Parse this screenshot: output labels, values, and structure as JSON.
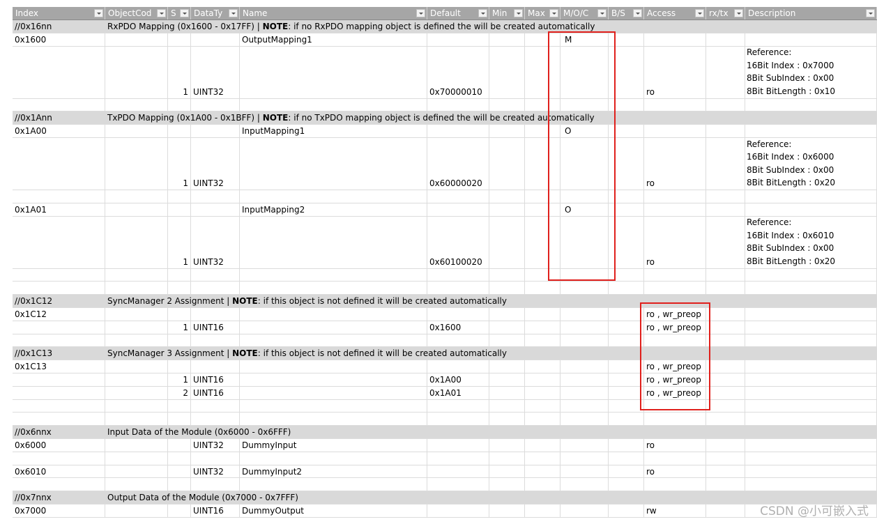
{
  "header": {
    "columns": [
      "Index",
      "ObjectCod",
      "S",
      "DataTy",
      "Name",
      "Default",
      "Min",
      "Max",
      "M/O/C",
      "B/S",
      "Access",
      "rx/tx",
      "Description"
    ]
  },
  "rows": [
    {
      "type": "section",
      "index": "//0x16nn",
      "title_prefix": "RxPDO Mapping (0x1600 - 0x17FF) | ",
      "note": "NOTE",
      "title_suffix": ": if no RxPDO mapping object is defined the will  be created automatically"
    },
    {
      "type": "data",
      "index": "0x1600",
      "name": "OutputMapping1",
      "moc": "M"
    },
    {
      "type": "entry",
      "sub": "1",
      "dtype": "UINT32",
      "default": "0x70000010",
      "access": "ro",
      "desc": "Reference:\n16Bit Index : 0x7000\n8Bit SubIndex : 0x00\n8Bit BitLength : 0x10"
    },
    {
      "type": "blank"
    },
    {
      "type": "section",
      "index": "//0x1Ann",
      "title_prefix": "TxPDO Mapping (0x1A00 - 0x1BFF) | ",
      "note": "NOTE",
      "title_suffix": ": if no TxPDO mapping object is defined the will  be created automatically"
    },
    {
      "type": "data",
      "index": "0x1A00",
      "name": "InputMapping1",
      "moc": "O"
    },
    {
      "type": "entry",
      "sub": "1",
      "dtype": "UINT32",
      "default": "0x60000020",
      "access": "ro",
      "desc": "Reference:\n16Bit Index : 0x6000\n8Bit SubIndex : 0x00\n8Bit BitLength : 0x20"
    },
    {
      "type": "blank"
    },
    {
      "type": "data",
      "index": "0x1A01",
      "name": "InputMapping2",
      "moc": "O"
    },
    {
      "type": "entry",
      "sub": "1",
      "dtype": "UINT32",
      "default": "0x60100020",
      "access": "ro",
      "desc": "Reference:\n16Bit Index : 0x6010\n8Bit SubIndex : 0x00\n8Bit BitLength : 0x20"
    },
    {
      "type": "blank"
    },
    {
      "type": "blank"
    },
    {
      "type": "section",
      "index": "//0x1C12",
      "title_prefix": "SyncManager 2 Assignment | ",
      "note": "NOTE",
      "title_suffix": ": if this object is not defined it will  be created automatically"
    },
    {
      "type": "data",
      "index": "0x1C12",
      "access": "ro , wr_preop"
    },
    {
      "type": "data",
      "sub": "1",
      "dtype": "UINT16",
      "default": "0x1600",
      "access": "ro , wr_preop"
    },
    {
      "type": "blank"
    },
    {
      "type": "section",
      "index": "//0x1C13",
      "title_prefix": "SyncManager 3 Assignment | ",
      "note": "NOTE",
      "title_suffix": ": if this object is not defined it will  be created automatically"
    },
    {
      "type": "data",
      "index": "0x1C13",
      "access": "ro , wr_preop"
    },
    {
      "type": "data",
      "sub": "1",
      "dtype": "UINT16",
      "default": "0x1A00",
      "access": "ro , wr_preop"
    },
    {
      "type": "data",
      "sub": "2",
      "dtype": "UINT16",
      "default": "0x1A01",
      "access": "ro , wr_preop"
    },
    {
      "type": "blank"
    },
    {
      "type": "blank"
    },
    {
      "type": "section",
      "index": "//0x6nnx",
      "title_prefix": "Input Data of the Module (0x6000 - 0x6FFF)",
      "note": "",
      "title_suffix": ""
    },
    {
      "type": "data",
      "index": "0x6000",
      "dtype": "UINT32",
      "name": "DummyInput",
      "access": "ro"
    },
    {
      "type": "blank"
    },
    {
      "type": "data",
      "index": "0x6010",
      "dtype": "UINT32",
      "name": "DummyInput2",
      "access": "ro"
    },
    {
      "type": "blank"
    },
    {
      "type": "section",
      "index": "//0x7nnx",
      "title_prefix": "Output Data of the Module (0x7000 - 0x7FFF)",
      "note": "",
      "title_suffix": ""
    },
    {
      "type": "data",
      "index": "0x7000",
      "dtype": "UINT16",
      "name": "DummyOutput",
      "access": "rw"
    }
  ],
  "highlight_color": "#e0201c",
  "watermark": "CSDN @小可嵌入式"
}
